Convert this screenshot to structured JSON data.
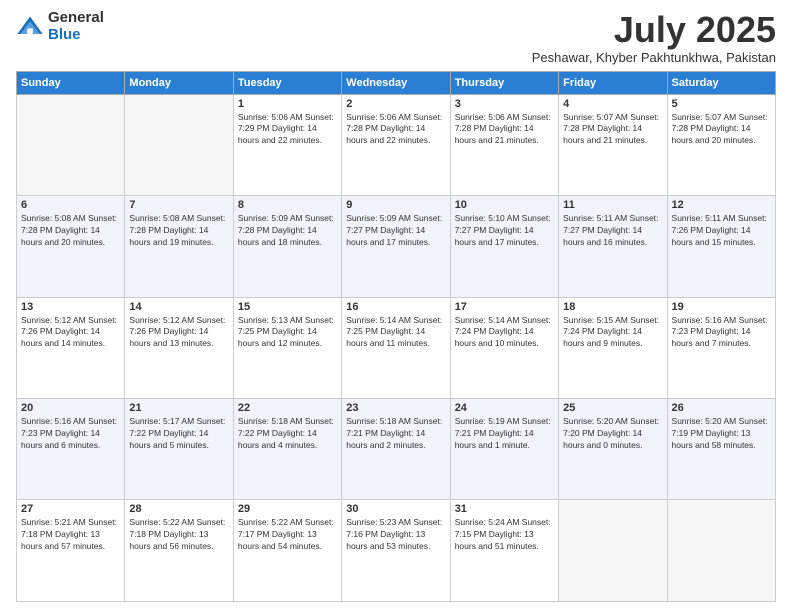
{
  "logo": {
    "general": "General",
    "blue": "Blue"
  },
  "title": "July 2025",
  "subtitle": "Peshawar, Khyber Pakhtunkhwa, Pakistan",
  "days_of_week": [
    "Sunday",
    "Monday",
    "Tuesday",
    "Wednesday",
    "Thursday",
    "Friday",
    "Saturday"
  ],
  "weeks": [
    [
      {
        "day": "",
        "info": ""
      },
      {
        "day": "",
        "info": ""
      },
      {
        "day": "1",
        "info": "Sunrise: 5:06 AM\nSunset: 7:29 PM\nDaylight: 14 hours and 22 minutes."
      },
      {
        "day": "2",
        "info": "Sunrise: 5:06 AM\nSunset: 7:28 PM\nDaylight: 14 hours and 22 minutes."
      },
      {
        "day": "3",
        "info": "Sunrise: 5:06 AM\nSunset: 7:28 PM\nDaylight: 14 hours and 21 minutes."
      },
      {
        "day": "4",
        "info": "Sunrise: 5:07 AM\nSunset: 7:28 PM\nDaylight: 14 hours and 21 minutes."
      },
      {
        "day": "5",
        "info": "Sunrise: 5:07 AM\nSunset: 7:28 PM\nDaylight: 14 hours and 20 minutes."
      }
    ],
    [
      {
        "day": "6",
        "info": "Sunrise: 5:08 AM\nSunset: 7:28 PM\nDaylight: 14 hours and 20 minutes."
      },
      {
        "day": "7",
        "info": "Sunrise: 5:08 AM\nSunset: 7:28 PM\nDaylight: 14 hours and 19 minutes."
      },
      {
        "day": "8",
        "info": "Sunrise: 5:09 AM\nSunset: 7:28 PM\nDaylight: 14 hours and 18 minutes."
      },
      {
        "day": "9",
        "info": "Sunrise: 5:09 AM\nSunset: 7:27 PM\nDaylight: 14 hours and 17 minutes."
      },
      {
        "day": "10",
        "info": "Sunrise: 5:10 AM\nSunset: 7:27 PM\nDaylight: 14 hours and 17 minutes."
      },
      {
        "day": "11",
        "info": "Sunrise: 5:11 AM\nSunset: 7:27 PM\nDaylight: 14 hours and 16 minutes."
      },
      {
        "day": "12",
        "info": "Sunrise: 5:11 AM\nSunset: 7:26 PM\nDaylight: 14 hours and 15 minutes."
      }
    ],
    [
      {
        "day": "13",
        "info": "Sunrise: 5:12 AM\nSunset: 7:26 PM\nDaylight: 14 hours and 14 minutes."
      },
      {
        "day": "14",
        "info": "Sunrise: 5:12 AM\nSunset: 7:26 PM\nDaylight: 14 hours and 13 minutes."
      },
      {
        "day": "15",
        "info": "Sunrise: 5:13 AM\nSunset: 7:25 PM\nDaylight: 14 hours and 12 minutes."
      },
      {
        "day": "16",
        "info": "Sunrise: 5:14 AM\nSunset: 7:25 PM\nDaylight: 14 hours and 11 minutes."
      },
      {
        "day": "17",
        "info": "Sunrise: 5:14 AM\nSunset: 7:24 PM\nDaylight: 14 hours and 10 minutes."
      },
      {
        "day": "18",
        "info": "Sunrise: 5:15 AM\nSunset: 7:24 PM\nDaylight: 14 hours and 9 minutes."
      },
      {
        "day": "19",
        "info": "Sunrise: 5:16 AM\nSunset: 7:23 PM\nDaylight: 14 hours and 7 minutes."
      }
    ],
    [
      {
        "day": "20",
        "info": "Sunrise: 5:16 AM\nSunset: 7:23 PM\nDaylight: 14 hours and 6 minutes."
      },
      {
        "day": "21",
        "info": "Sunrise: 5:17 AM\nSunset: 7:22 PM\nDaylight: 14 hours and 5 minutes."
      },
      {
        "day": "22",
        "info": "Sunrise: 5:18 AM\nSunset: 7:22 PM\nDaylight: 14 hours and 4 minutes."
      },
      {
        "day": "23",
        "info": "Sunrise: 5:18 AM\nSunset: 7:21 PM\nDaylight: 14 hours and 2 minutes."
      },
      {
        "day": "24",
        "info": "Sunrise: 5:19 AM\nSunset: 7:21 PM\nDaylight: 14 hours and 1 minute."
      },
      {
        "day": "25",
        "info": "Sunrise: 5:20 AM\nSunset: 7:20 PM\nDaylight: 14 hours and 0 minutes."
      },
      {
        "day": "26",
        "info": "Sunrise: 5:20 AM\nSunset: 7:19 PM\nDaylight: 13 hours and 58 minutes."
      }
    ],
    [
      {
        "day": "27",
        "info": "Sunrise: 5:21 AM\nSunset: 7:18 PM\nDaylight: 13 hours and 57 minutes."
      },
      {
        "day": "28",
        "info": "Sunrise: 5:22 AM\nSunset: 7:18 PM\nDaylight: 13 hours and 56 minutes."
      },
      {
        "day": "29",
        "info": "Sunrise: 5:22 AM\nSunset: 7:17 PM\nDaylight: 13 hours and 54 minutes."
      },
      {
        "day": "30",
        "info": "Sunrise: 5:23 AM\nSunset: 7:16 PM\nDaylight: 13 hours and 53 minutes."
      },
      {
        "day": "31",
        "info": "Sunrise: 5:24 AM\nSunset: 7:15 PM\nDaylight: 13 hours and 51 minutes."
      },
      {
        "day": "",
        "info": ""
      },
      {
        "day": "",
        "info": ""
      }
    ]
  ]
}
